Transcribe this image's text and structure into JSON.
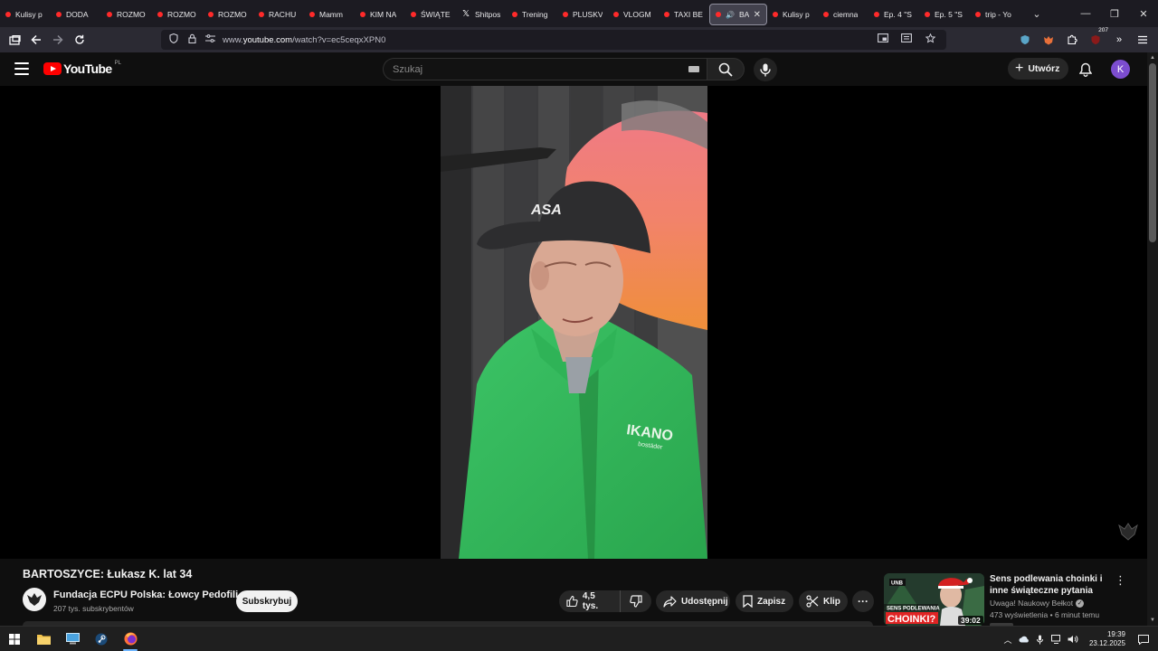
{
  "browser": {
    "tabs": [
      {
        "label": "Kulisy p",
        "icon": "youtube-favicon"
      },
      {
        "label": "DODA",
        "icon": "youtube-favicon"
      },
      {
        "label": "ROZMO",
        "icon": "youtube-favicon"
      },
      {
        "label": "ROZMO",
        "icon": "youtube-favicon"
      },
      {
        "label": "ROZMO",
        "icon": "youtube-favicon"
      },
      {
        "label": "RACHU",
        "icon": "youtube-favicon"
      },
      {
        "label": "Mamm",
        "icon": "youtube-favicon"
      },
      {
        "label": "KIM NA",
        "icon": "youtube-favicon"
      },
      {
        "label": "ŚWIĄTE",
        "icon": "youtube-favicon"
      },
      {
        "label": "Shitpos",
        "icon": "x-favicon"
      },
      {
        "label": "Trening",
        "icon": "youtube-favicon"
      },
      {
        "label": "PLUSKV",
        "icon": "youtube-favicon"
      },
      {
        "label": "VLOGM",
        "icon": "youtube-favicon"
      },
      {
        "label": "TAXI BE",
        "icon": "youtube-favicon"
      },
      {
        "label": "BAR",
        "icon": "youtube-favicon",
        "active": true
      },
      {
        "label": "Kulisy p",
        "icon": "youtube-favicon"
      },
      {
        "label": "ciemna",
        "icon": "youtube-favicon"
      },
      {
        "label": "Ep. 4 \"S",
        "icon": "youtube-favicon"
      },
      {
        "label": "Ep. 5 \"S",
        "icon": "youtube-favicon"
      },
      {
        "label": "trip - Yo",
        "icon": "youtube-favicon"
      }
    ],
    "url_prefix": "www.",
    "url_domain": "youtube.com",
    "url_rest": "/watch?v=ec5ceqxXPN0",
    "extensions_badge": "207"
  },
  "youtube": {
    "logo_text": "YouTube",
    "country_code": "PL",
    "search_placeholder": "Szukaj",
    "create_label": "Utwórz",
    "avatar_letter": "K"
  },
  "video": {
    "title": "BARTOSZYCE: Łukasz K. lat 34",
    "channel_name": "Fundacja ECPU Polska: Łowcy Pedofili",
    "subscribers": "207 tys. subskrybentów",
    "subscribe_label": "Subskrybuj",
    "likes": "4,5 tys.",
    "share_label": "Udostępnij",
    "save_label": "Zapisz",
    "clip_label": "Klip",
    "shirt_text": "IKANO",
    "shirt_subtext": "bostäder",
    "cap_logo": "ASA"
  },
  "recommendation": {
    "title": "Sens podlewania choinki i inne świąteczne pytania",
    "channel": "Uwaga! Naukowy Bełkot",
    "views": "473 wyświetlenia",
    "age": "6 minut temu",
    "duration": "39:02",
    "thumb_top_text": "SENS PODLEWANIA",
    "thumb_big_text": "CHOINKI?",
    "thumb_logo": "UNB"
  },
  "taskbar": {
    "time": "19:39",
    "date": "23.12.2025"
  },
  "colors": {
    "youtube_red": "#ff0000",
    "page_bg": "#0f0f0f",
    "avatar_purple": "#7c4dcf"
  }
}
